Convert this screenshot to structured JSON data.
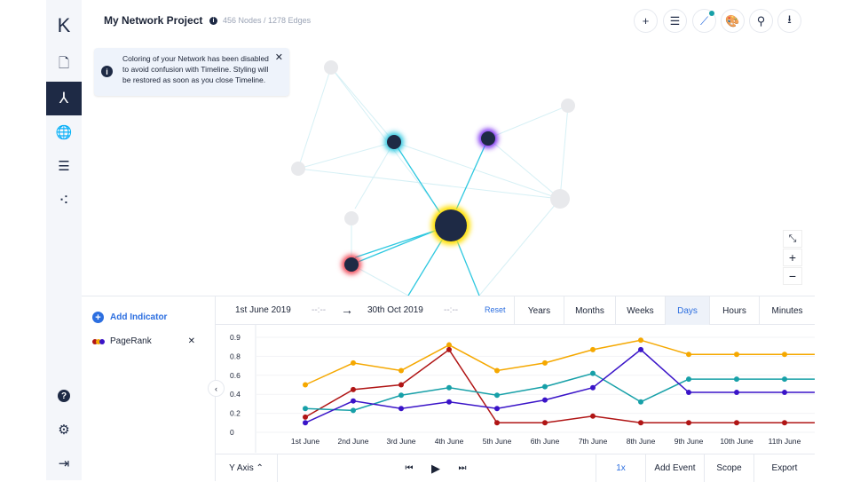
{
  "header": {
    "title": "My Network Project",
    "stats": "456 Nodes / 1278 Edges"
  },
  "sidebar": {
    "items": [
      {
        "icon": "logo-k-icon",
        "glyph": "K"
      },
      {
        "icon": "document-icon",
        "glyph": "🗋"
      },
      {
        "icon": "network-icon",
        "glyph": "⅄",
        "active": true
      },
      {
        "icon": "globe-icon",
        "glyph": "🌐"
      },
      {
        "icon": "list-icon",
        "glyph": "☰"
      },
      {
        "icon": "cluster-icon",
        "glyph": "⁖"
      },
      {
        "icon": "help-icon",
        "glyph": "?"
      },
      {
        "icon": "settings-icon",
        "glyph": "⚙"
      },
      {
        "icon": "logout-icon",
        "glyph": "⇥"
      }
    ]
  },
  "toast": {
    "text": "Coloring of your Network has been disabled to avoid confusion with Timeline. Styling will be restored as soon as you close Timeline.",
    "close": "✕"
  },
  "toolbar": [
    {
      "icon": "add-icon",
      "glyph": "+"
    },
    {
      "icon": "filter-icon",
      "glyph": "☰"
    },
    {
      "icon": "timeline-icon",
      "glyph": "⟋"
    },
    {
      "icon": "palette-icon",
      "glyph": "🎨"
    },
    {
      "icon": "search-icon",
      "glyph": "⚲"
    },
    {
      "icon": "download-icon",
      "glyph": "⭳"
    }
  ],
  "zoom": {
    "fit": "⤡",
    "in": "+",
    "out": "−"
  },
  "timeline": {
    "add_indicator": "Add Indicator",
    "indicator": "PageRank",
    "remove": "✕",
    "start_date": "1st June 2019",
    "start_time": "--:--",
    "arrow": "→",
    "end_date": "30th Oct 2019",
    "end_time": "--:--",
    "reset": "Reset",
    "granularity": [
      "Years",
      "Months",
      "Weeks",
      "Days",
      "Hours",
      "Minutes"
    ],
    "selected": "Days",
    "y_axis": "Y Axis ⌃",
    "play_controls": [
      "⏮",
      "▶",
      "⏭"
    ],
    "speed": "1x",
    "add_event": "Add Event",
    "scope": "Scope",
    "export": "Export"
  },
  "chart_data": {
    "type": "line",
    "categories": [
      "1st June",
      "2nd June",
      "3rd June",
      "4th June",
      "5th June",
      "6th June",
      "7th June",
      "8th June",
      "9th June",
      "10th June",
      "11th June"
    ],
    "ytick_labels": [
      "0",
      "0.2",
      "0.4",
      "0.6",
      "0.8",
      "0.9"
    ],
    "ylim": [
      0,
      1.0
    ],
    "grid": true,
    "series": [
      {
        "color": "#f5a800",
        "values": [
          0.5,
          0.73,
          0.65,
          0.92,
          0.65,
          0.73,
          0.87,
          0.97,
          0.82,
          0.82,
          0.82
        ]
      },
      {
        "color": "#b01515",
        "values": [
          0.16,
          0.45,
          0.5,
          0.87,
          0.1,
          0.1,
          0.17,
          0.1,
          0.1,
          0.1,
          0.1
        ]
      },
      {
        "color": "#17a0a8",
        "values": [
          0.25,
          0.23,
          0.39,
          0.47,
          0.39,
          0.48,
          0.62,
          0.32,
          0.56,
          0.56,
          0.56
        ]
      },
      {
        "color": "#3a14c8",
        "values": [
          0.1,
          0.33,
          0.25,
          0.32,
          0.25,
          0.34,
          0.47,
          0.87,
          0.42,
          0.42,
          0.42
        ]
      }
    ]
  }
}
